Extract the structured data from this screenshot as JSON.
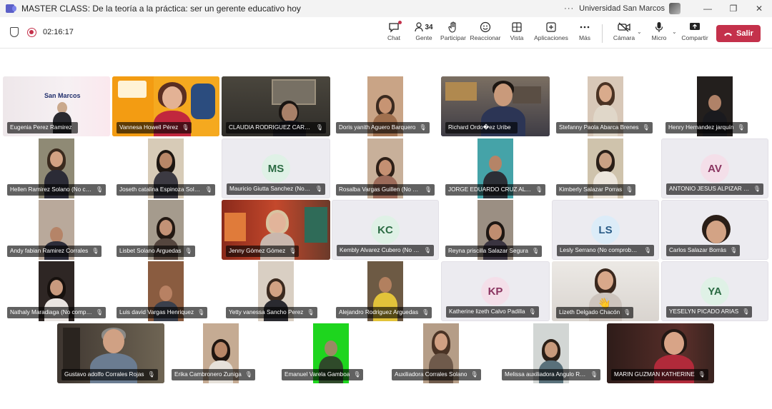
{
  "window": {
    "title": "MASTER CLASS: De la teoría a la práctica: ser un gerente educativo hoy",
    "more": "···",
    "org": "Universidad San Marcos",
    "minimize": "—",
    "maximize": "❐",
    "close": "✕"
  },
  "toolbar": {
    "timer": "02:16:17",
    "chat": "Chat",
    "people": "Gente",
    "people_count": "34",
    "raise": "Participar",
    "react": "Reaccionar",
    "view": "Vista",
    "apps": "Aplicaciones",
    "more": "Más",
    "camera": "Cámara",
    "mic": "Micro",
    "share": "Compartir",
    "leave": "Salir"
  },
  "banner_text": "San Marcos",
  "participants": [
    {
      "name": "Eugenia Perez Ramirez"
    },
    {
      "name": "Vannesa Howell Pérez"
    },
    {
      "name": "CLAUDIA RODRIGUEZ CARVAJAL"
    },
    {
      "name": "Doris yanith Aguero Barquero"
    },
    {
      "name": "Richard Ordo�ez Uribe"
    },
    {
      "name": "Stefanny Paola Abarca Brenes"
    },
    {
      "name": "Henry Hernandez jarquín"
    },
    {
      "name": "Hellen Ramirez Solano (No comprobado)"
    },
    {
      "name": "Joseth catalina Espinoza Solano"
    },
    {
      "name": "Mauricio Giutta Sanchez (No comprobado)",
      "initials": "MS"
    },
    {
      "name": "Rosalba Vargas Guillen (No comprobado)"
    },
    {
      "name": "JORGE EDUARDO CRUZ ALVAREZ"
    },
    {
      "name": "Kimberly Salazar Porras"
    },
    {
      "name": "ANTONIO JESUS ALPIZAR CORDERO",
      "initials": "AV"
    },
    {
      "name": "Andy fabian Ramirez Corrales"
    },
    {
      "name": "Lisbet Solano Arguedas"
    },
    {
      "name": "Jenny Gómez Gómez"
    },
    {
      "name": "Kembly Alvarez Cubero (No comprobado)",
      "initials": "KC"
    },
    {
      "name": "Reyna priscilla Salazar Segura"
    },
    {
      "name": "Lesly Serrano (No comprobado)",
      "initials": "LS"
    },
    {
      "name": "Carlos Salazar Borrás"
    },
    {
      "name": "Nathaly Maradiaga (No comprobado)"
    },
    {
      "name": "Luis david Vargas Henriquez"
    },
    {
      "name": "Yetty vanessa Sancho Perez"
    },
    {
      "name": "Alejandro Rodriguez Arguedas"
    },
    {
      "name": "Katherine lizeth Calvo Padilla",
      "initials": "KP"
    },
    {
      "name": "Lizeth Delgado Chacón"
    },
    {
      "name": "YESELYN PICADO ARIAS",
      "initials": "YA"
    },
    {
      "name": "Gustavo adolfo Corrales Rojas"
    },
    {
      "name": "Erika Cambronero Zuniga"
    },
    {
      "name": "Emanuel Varela Gamboa"
    },
    {
      "name": "Auxiliadora Corrales Solano"
    },
    {
      "name": "Melissa auxiliadora Angulo Rojas"
    },
    {
      "name": "MARIN GUZMAN KATHERINE"
    }
  ]
}
